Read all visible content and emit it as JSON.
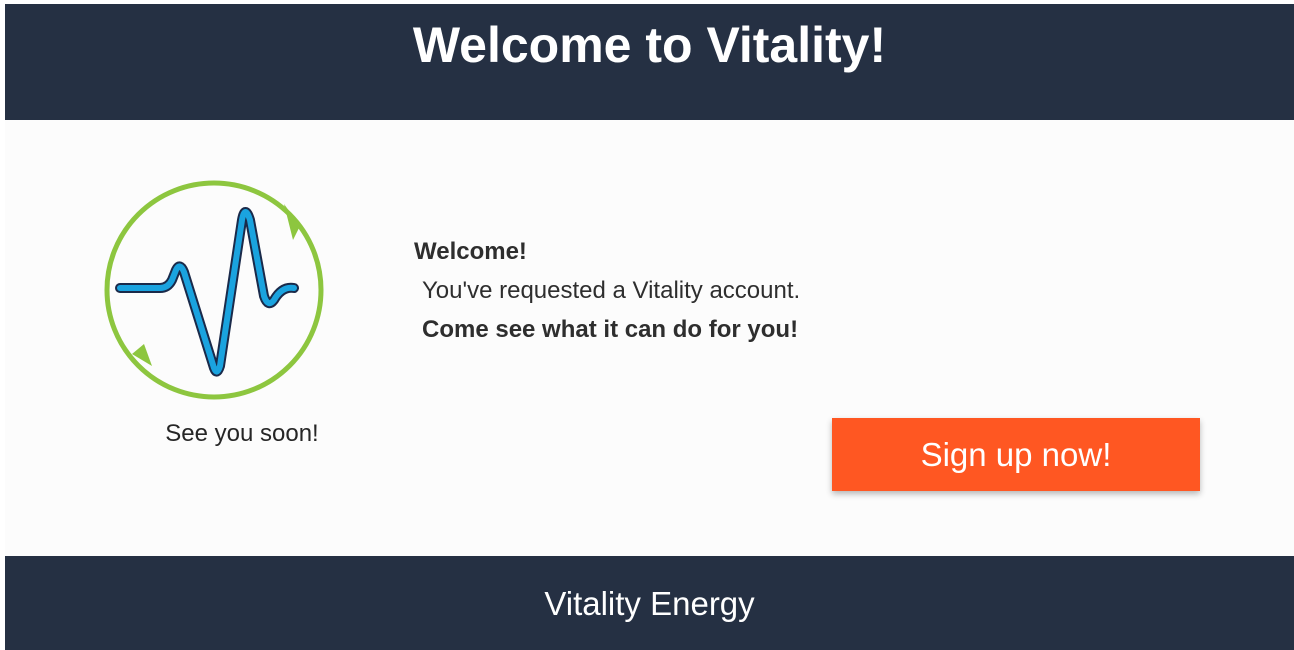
{
  "header": {
    "title": "Welcome to Vitality!"
  },
  "logo": {
    "icon": "heartbeat-pulse-icon",
    "ring_color": "#8dc63f",
    "line_color": "#1aa3df"
  },
  "caption": "See you soon!",
  "message": {
    "greeting": "Welcome!",
    "detail": "You've requested a Vitality account.",
    "cta_line": "Come see what it can do for you!"
  },
  "signup_button": {
    "label": "Sign up now!",
    "color": "#ff5722"
  },
  "footer": {
    "text": "Vitality Energy"
  },
  "colors": {
    "header_bg": "#253043",
    "footer_bg": "#253043",
    "body_bg": "#fcfcfc"
  }
}
